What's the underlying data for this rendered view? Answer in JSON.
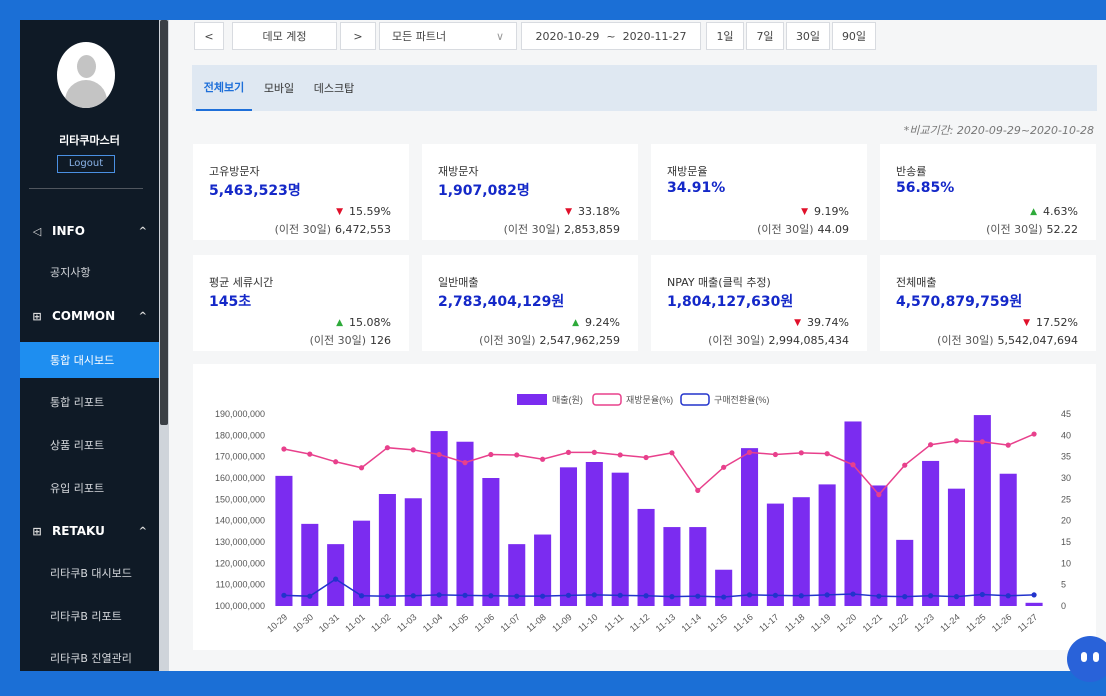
{
  "sidebar": {
    "username": "리타쿠마스터",
    "logout_label": "Logout",
    "sections": [
      {
        "icon": "megaphone-icon",
        "glyph": "◁",
        "label": "INFO",
        "chevron": "^"
      },
      {
        "icon": "grid-icon",
        "glyph": "⊞",
        "label": "COMMON",
        "chevron": "^"
      },
      {
        "icon": "grid-icon",
        "glyph": "⊞",
        "label": "RETAKU",
        "chevron": "^"
      }
    ],
    "items": [
      {
        "label": "공지사항"
      },
      {
        "label": "통합 대시보드",
        "active": true
      },
      {
        "label": "통합 리포트"
      },
      {
        "label": "상품 리포트"
      },
      {
        "label": "유입 리포트"
      },
      {
        "label": "리타쿠B 대시보드"
      },
      {
        "label": "리타쿠B 리포트"
      },
      {
        "label": "리타쿠B 진열관리"
      }
    ]
  },
  "filters": {
    "prev": "<",
    "account": "데모 계정",
    "next": ">",
    "partner": "모든 파트너",
    "partner_chevron": "∨",
    "date_range": "2020-10-29  ~  2020-11-27",
    "periods": [
      "1일",
      "7일",
      "30일",
      "90일"
    ]
  },
  "tabs": [
    "전체보기",
    "모바일",
    "데스크탑"
  ],
  "compare_period": "*비교기간: 2020-09-29~2020-10-28",
  "cards": [
    {
      "title": "고유방문자",
      "value": "5,463,523명",
      "dir": "down",
      "change": "15.59%",
      "prev_label": "(이전 30일)",
      "prev_value": "6,472,553"
    },
    {
      "title": "재방문자",
      "value": "1,907,082명",
      "dir": "down",
      "change": "33.18%",
      "prev_label": "(이전 30일)",
      "prev_value": "2,853,859"
    },
    {
      "title": "재방문율",
      "value": "34.91%",
      "dir": "down",
      "change": "9.19%",
      "prev_label": "(이전 30일)",
      "prev_value": "44.09"
    },
    {
      "title": "반송률",
      "value": "56.85%",
      "dir": "up",
      "change": "4.63%",
      "prev_label": "(이전 30일)",
      "prev_value": "52.22"
    },
    {
      "title": "평균 세류시간",
      "value": "145초",
      "dir": "up",
      "change": "15.08%",
      "prev_label": "(이전 30일)",
      "prev_value": "126"
    },
    {
      "title": "일반매출",
      "value": "2,783,404,129원",
      "dir": "up",
      "change": "9.24%",
      "prev_label": "(이전 30일)",
      "prev_value": "2,547,962,259"
    },
    {
      "title": "NPAY 매출(클릭 추정)",
      "value": "1,804,127,630원",
      "dir": "down",
      "change": "39.74%",
      "prev_label": "(이전 30일)",
      "prev_value": "2,994,085,434"
    },
    {
      "title": "전체매출",
      "value": "4,570,879,759원",
      "dir": "down",
      "change": "17.52%",
      "prev_label": "(이전 30일)",
      "prev_value": "5,542,047,694"
    }
  ],
  "colors": {
    "bar": "#7b2cf0",
    "revisit_line": "#e8408c",
    "conversion_line": "#2233cc",
    "active_nav": "#1e8ef0",
    "value_text": "#1428c8"
  },
  "chart_data": {
    "type": "bar",
    "categories": [
      "10-29",
      "10-30",
      "10-31",
      "11-01",
      "11-02",
      "11-03",
      "11-04",
      "11-05",
      "11-06",
      "11-07",
      "11-08",
      "11-09",
      "11-10",
      "11-11",
      "11-12",
      "11-13",
      "11-14",
      "11-15",
      "11-16",
      "11-17",
      "11-18",
      "11-19",
      "11-20",
      "11-21",
      "11-22",
      "11-23",
      "11-24",
      "11-25",
      "11-26",
      "11-27"
    ],
    "legend": [
      "매출(원)",
      "재방문율(%)",
      "구매전환율(%)"
    ],
    "ylim": [
      100000000,
      190000000
    ],
    "y_ticks": [
      "100,000,000",
      "110,000,000",
      "120,000,000",
      "130,000,000",
      "140,000,000",
      "150,000,000",
      "160,000,000",
      "170,000,000",
      "180,000,000",
      "190,000,000"
    ],
    "y2lim": [
      0,
      45
    ],
    "y2_ticks": [
      "0",
      "5",
      "10",
      "15",
      "20",
      "25",
      "30",
      "35",
      "40",
      "45"
    ],
    "series": [
      {
        "name": "매출(원)",
        "type": "bar",
        "axis": "left",
        "values": [
          161000000,
          138500000,
          129000000,
          140000000,
          152500000,
          150500000,
          182000000,
          177000000,
          160000000,
          129000000,
          133500000,
          165000000,
          167500000,
          162500000,
          145500000,
          137000000,
          137000000,
          117000000,
          174000000,
          148000000,
          151000000,
          157000000,
          186500000,
          156500000,
          131000000,
          168000000,
          155000000,
          189500000,
          162000000,
          101500000
        ]
      },
      {
        "name": "재방문율(%)",
        "type": "line",
        "axis": "right",
        "values": [
          36.8,
          35.6,
          33.8,
          32.4,
          37.1,
          36.6,
          35.5,
          33.6,
          35.5,
          35.4,
          34.4,
          36.0,
          36.0,
          35.4,
          34.8,
          35.9,
          27.1,
          32.5,
          36.0,
          35.5,
          35.9,
          35.7,
          33.1,
          26.1,
          33.0,
          37.8,
          38.7,
          38.5,
          37.7,
          40.3
        ]
      },
      {
        "name": "구매전환율(%)",
        "type": "line",
        "axis": "right",
        "values": [
          2.5,
          2.3,
          6.3,
          2.4,
          2.3,
          2.4,
          2.6,
          2.5,
          2.4,
          2.3,
          2.3,
          2.5,
          2.6,
          2.5,
          2.4,
          2.2,
          2.3,
          2.1,
          2.6,
          2.5,
          2.4,
          2.6,
          2.8,
          2.3,
          2.2,
          2.4,
          2.2,
          2.7,
          2.4,
          2.6
        ]
      }
    ]
  }
}
